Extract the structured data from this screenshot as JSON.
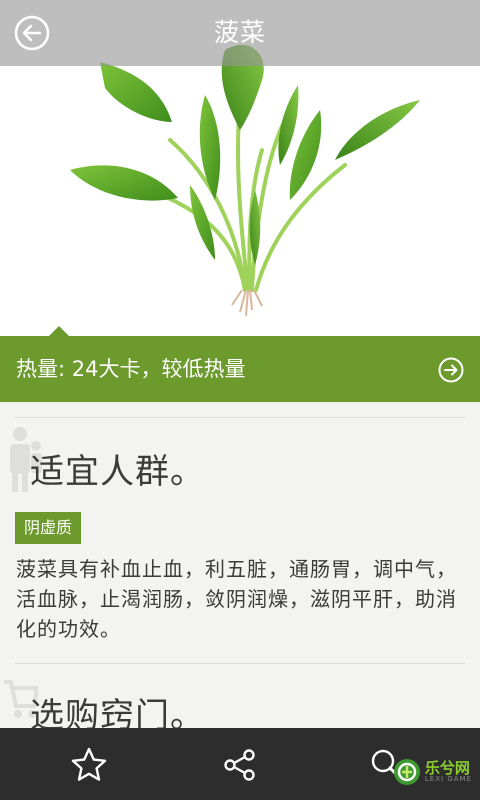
{
  "header": {
    "title": "菠菜"
  },
  "calorie_bar": {
    "text": "热量: 24大卡，较低热量"
  },
  "sections": [
    {
      "title": "适宜人群。",
      "tag": "阴虚质",
      "description": "菠菜具有补血止血，利五脏，通肠胃，调中气，活血脉，止渴润肠，敛阴润燥，滋阴平肝，助消化的功效。"
    },
    {
      "title": "选购窍门。"
    }
  ],
  "toolbar": {
    "favorite_icon": "star-outline-icon",
    "share_icon": "share-icon",
    "search_icon": "search-icon"
  },
  "brand": {
    "name": "乐兮网",
    "sub": "LEXI GAME"
  },
  "colors": {
    "accent_green": "#6c9a2d",
    "toolbar_bg": "#2d2d2d",
    "content_bg": "#f3f3f1"
  }
}
